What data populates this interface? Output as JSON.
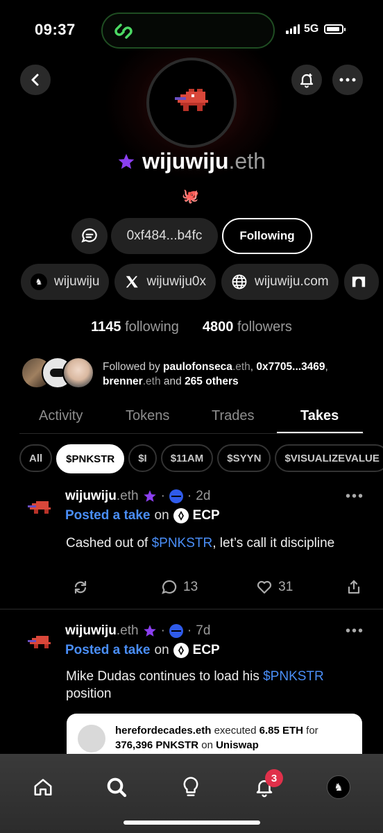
{
  "status": {
    "time": "09:37",
    "network": "5G"
  },
  "profile": {
    "name": "wijuwiju",
    "name_suffix": ".eth",
    "emoji": "🐙",
    "address": "0xf484...b4fc",
    "follow_label": "Following"
  },
  "socials": [
    {
      "label": "wijuwiju",
      "icon": "avatar-icon"
    },
    {
      "label": "wijuwiju0x",
      "icon": "x-logo-icon"
    },
    {
      "label": "wijuwiju.com",
      "icon": "globe-icon"
    }
  ],
  "stats": {
    "following_count": "1145",
    "following_label": "following",
    "followers_count": "4800",
    "followers_label": "followers"
  },
  "followed_by": {
    "prefix": "Followed by ",
    "user1": "paulofonseca",
    "user1_suffix": ".eth",
    "sep1": ", ",
    "user2": "0x7705...3469",
    "sep2": ",",
    "user3": "brenner",
    "user3_suffix": ".eth",
    "mid": " and ",
    "others": "265 others"
  },
  "tabs": [
    "Activity",
    "Tokens",
    "Trades",
    "Takes"
  ],
  "active_tab": "Takes",
  "chips": [
    "All",
    "$PNKSTR",
    "$I",
    "$11AM",
    "$SYYN",
    "$VISUALIZEVALUE"
  ],
  "active_chip": "$PNKSTR",
  "posts": [
    {
      "author": "wijuwiju",
      "author_suffix": ".eth",
      "age": "2d",
      "action": "Posted a take",
      "on": "on",
      "platform": "ECP",
      "text_before": "Cashed out of ",
      "ticker": "$PNKSTR",
      "text_after": ", let’s call it discipline",
      "comments": "13",
      "likes": "31"
    },
    {
      "author": "wijuwiju",
      "author_suffix": ".eth",
      "age": "7d",
      "action": "Posted a take",
      "on": "on",
      "platform": "ECP",
      "text_before": "Mike Dudas continues to load his ",
      "ticker": "$PNKSTR",
      "text_after": " position",
      "trade": {
        "user": "herefordecades.eth",
        "verb": "executed",
        "amount": "6.85 ETH",
        "for": "for",
        "qty": "376,396 PNKSTR",
        "on": "on",
        "venue": "Uniswap"
      }
    }
  ],
  "nav": [
    "home-icon",
    "search-icon",
    "lightbulb-icon",
    "bell-icon",
    "profile-avatar-icon"
  ],
  "notifications_badge": "3",
  "colors": {
    "accent_link": "#4a8ef7",
    "badge": "#e0304a",
    "star": "#8b3ff0",
    "island_border": "#1f4d22"
  }
}
